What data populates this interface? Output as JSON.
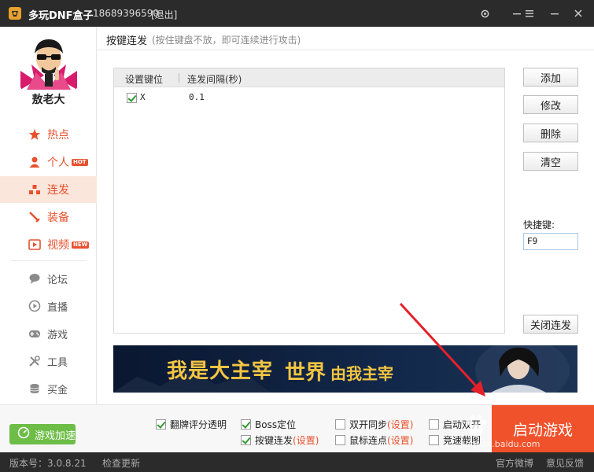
{
  "window": {
    "title": "多玩DNF盒子",
    "phone": "18689396590",
    "logout": "[退出]"
  },
  "user": {
    "name": "敖老大"
  },
  "nav": {
    "primary": [
      {
        "label": "热点",
        "icon": "star-icon"
      },
      {
        "label": "个人",
        "icon": "person-icon",
        "badge": "HOT"
      },
      {
        "label": "连发",
        "icon": "bars-icon",
        "active": true
      },
      {
        "label": "装备",
        "icon": "sword-icon"
      },
      {
        "label": "视频",
        "icon": "play-icon",
        "badge": "NEW"
      }
    ],
    "secondary": [
      {
        "label": "论坛",
        "icon": "chat-icon"
      },
      {
        "label": "直播",
        "icon": "live-icon"
      },
      {
        "label": "游戏",
        "icon": "gamepad-icon"
      },
      {
        "label": "工具",
        "icon": "tools-icon"
      },
      {
        "label": "买金",
        "icon": "coins-icon"
      }
    ]
  },
  "header": {
    "title": "按键连发",
    "hint": "(按住键盘不放，即可连续进行攻击)"
  },
  "table": {
    "columns": [
      "设置键位",
      "连发间隔(秒)"
    ],
    "rows": [
      {
        "checked": true,
        "key": "X",
        "interval": "0.1"
      }
    ]
  },
  "actions": {
    "add": "添加",
    "edit": "修改",
    "delete": "删除",
    "clear": "清空",
    "hotkey_label": "快捷键:",
    "hotkey_value": "F9",
    "close": "关闭连发"
  },
  "banner": {
    "left_text": "我是大主宰",
    "right_text_a": "世界",
    "right_text_b": "由我主宰"
  },
  "footer": {
    "speed_button": "游戏加速",
    "options": [
      {
        "label": "翻牌评分透明",
        "checked": true
      },
      {
        "label": "Boss定位",
        "checked": true
      },
      {
        "label": "双开同步",
        "checked": false,
        "setting": "(设置)"
      },
      {
        "label": "启动双开",
        "checked": false
      },
      {
        "label": "按键连发",
        "checked": true,
        "setting": "(设置)"
      },
      {
        "label": "鼠标连点",
        "checked": false,
        "setting": "(设置)"
      },
      {
        "label": "竞速截图",
        "checked": false
      }
    ],
    "start_button": "启动游戏"
  },
  "status": {
    "version": "版本号：3.0.8.21",
    "check_update": "检查更新",
    "weibo": "官方微博",
    "feedback": "意见反馈"
  },
  "watermark": {
    "text": "jingyan.baidu.com"
  },
  "colors": {
    "accent": "#e8512e",
    "titlebar": "#2b2b2b",
    "active_bg": "#fbe6dc",
    "speed_green": "#6dbd46",
    "start_orange": "#f0522b",
    "annotation_red": "#e6202a"
  }
}
